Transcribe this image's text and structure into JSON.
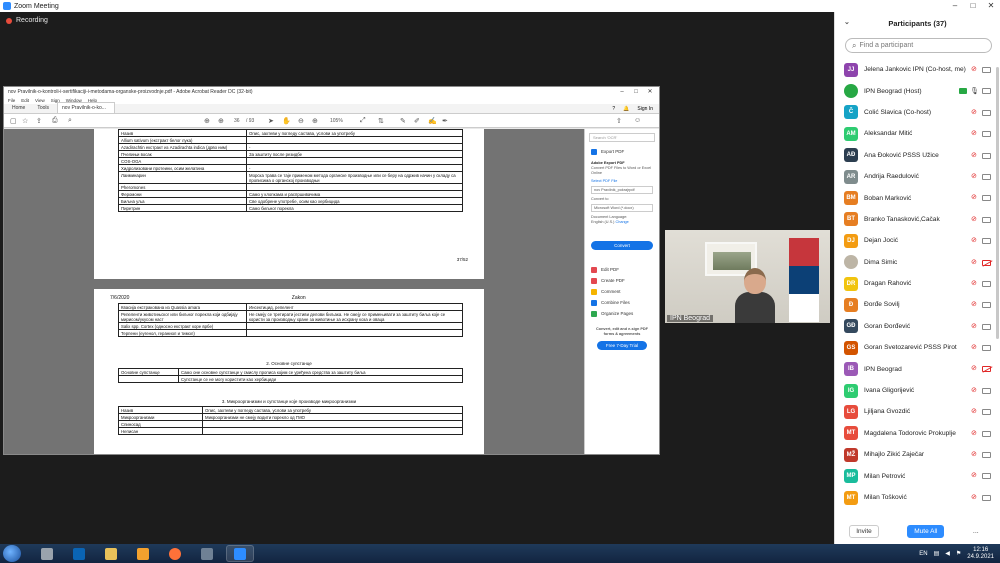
{
  "zoom": {
    "window_title": "Zoom Meeting",
    "recording_label": "Recording"
  },
  "acrobat": {
    "title": "nov Pravilnik-o-kontroli-i-sertifikaciji-i-metodama-organske-proizvodnje.pdf - Adobe Acrobat Reader DC (32-bit)",
    "menu": [
      "File",
      "Edit",
      "View",
      "Sign",
      "Window",
      "Help"
    ],
    "tabs": [
      "Home",
      "Tools",
      "nov Pravilnik-o-ko..."
    ],
    "sign_in": "Sign In",
    "page_indicator": "36",
    "page_total": "/ 93",
    "zoom_level": "105%",
    "page1": {
      "rows": [
        [
          "Назив",
          "Опис, захтеви у погледу састава, услови за употребу"
        ],
        [
          "Allium sativum (екстракт белог лука)",
          ""
        ],
        [
          "Azadirachtin екстракт из Azadirachta indica (дрво ним)",
          "-"
        ],
        [
          "Пчелињи восак",
          "За заштиту после резидбе"
        ],
        [
          "COS-OGA",
          ""
        ],
        [
          "Хидролизовани протеини, осим желатина",
          "-"
        ],
        [
          "Лаиминарин",
          "Морска трава се тaje применом метода органске производње или се беру на одржив начин у складу са прописима о органској производњи"
        ],
        [
          "Pheromones",
          ""
        ],
        [
          "Феромони",
          "Само у клопкама и распршивачима"
        ],
        [
          "Биљна уља",
          "Све одобрене употребе, осим као хербицида"
        ],
        [
          "Пиретрин",
          "Само биљног порекла"
        ]
      ],
      "page_number": "37/52"
    },
    "page2": {
      "date": "7/6/2020",
      "header_title": "Zakon",
      "rows": [
        [
          "Квасија екстракована из Quassia amara",
          "Инсектицид, репелент"
        ],
        [
          "Репеленти животињског или биљног порекла који одбијају мирисом/укусом наст",
          "Не смеју се третирати јестиви делови биљака. Не смеју се примењивати за заштиту биља које се користи за производњу хране за животиње за исхрану коза и оваца"
        ],
        [
          "Salix spp. Cortex (односно екстракт коре врбе)",
          ""
        ],
        [
          "Терпени (еугенол, гераниол и тимол)",
          ""
        ]
      ],
      "section2_title": "2. Основне супстанце",
      "section2_rows": [
        [
          "Основне супстанце",
          "Само оне основне супстанце у смислу прописа којим се уређена средства за заштиту биља"
        ],
        [
          "",
          "Супстанце се не могу користити као хербициди"
        ]
      ],
      "section3_title": "3. Микроорганизми и супстанце које производе микроорганизми",
      "section3_rows": [
        [
          "Назив",
          "Опис, захтеви у погледу састава, услови за употребу"
        ],
        [
          "Микроорганизми",
          "Микроорганизми не смеју водити порекло од ГМО"
        ],
        [
          "Спиносад",
          ""
        ],
        [
          "Неписан",
          ""
        ]
      ]
    },
    "right_panel": {
      "search_placeholder": "Search 'OCR'",
      "export_pdf": "Export PDF",
      "adobe_export_title": "Adobe Export PDF",
      "adobe_export_desc": "Convert PDF Files to Word or Excel Online",
      "select_pdf": "Select PDF File",
      "selected_file": "nov Pravilnik_pokrajrpdf",
      "convert_to": "Convert to",
      "format": "Microsoft Word (*.docx)",
      "doc_lang": "Document Language:",
      "lang_value": "English (U.S.)",
      "change": "Change",
      "convert_btn": "Convert",
      "tools": [
        "Edit PDF",
        "Create PDF",
        "Comment",
        "Combine Files",
        "Organize Pages"
      ],
      "promo": "Convert, edit and e-sign PDF forms & agreements",
      "trial_btn": "Free 7-Day Trial"
    }
  },
  "video": {
    "name": "IPN Beograd"
  },
  "participants": {
    "title": "Participants (37)",
    "search_placeholder": "Find a participant",
    "list": [
      {
        "initials": "JJ",
        "name": "Jelena Jankovic IPN (Co-host, me)",
        "color": "#8e44ad",
        "mic": "muted",
        "cam": "off"
      },
      {
        "initials": "",
        "name": "IPN Beograd (Host)",
        "color": "#27a844",
        "mic": "on",
        "cam": "on",
        "photo": true
      },
      {
        "initials": "Č",
        "name": "Čolić Slavica (Co-host)",
        "color": "#16a3c6",
        "mic": "muted",
        "cam": "off"
      },
      {
        "initials": "AM",
        "name": "Aleksandar Mitić",
        "color": "#2ecc71",
        "mic": "muted",
        "cam": "off"
      },
      {
        "initials": "AĐ",
        "name": "Ana Đoković PSSS Užice",
        "color": "#2c3e50",
        "mic": "muted",
        "cam": "off"
      },
      {
        "initials": "AR",
        "name": "Andrija Raedulović",
        "color": "#7f8c8d",
        "mic": "muted",
        "cam": "off"
      },
      {
        "initials": "BM",
        "name": "Boban Marković",
        "color": "#e67e22",
        "mic": "muted",
        "cam": "off"
      },
      {
        "initials": "BT",
        "name": "Branko Tanasković,Čačak",
        "color": "#e67e22",
        "mic": "muted",
        "cam": "off"
      },
      {
        "initials": "DJ",
        "name": "Dejan Jocić",
        "color": "#f39c12",
        "mic": "muted",
        "cam": "off"
      },
      {
        "initials": "",
        "name": "Dima Simic",
        "color": "#bdb5a6",
        "mic": "muted",
        "cam": "red",
        "photo": true
      },
      {
        "initials": "DR",
        "name": "Dragan Rahović",
        "color": "#f1c40f",
        "mic": "muted",
        "cam": "off"
      },
      {
        "initials": "Đ",
        "name": "Đorđe Sovilj",
        "color": "#e67e22",
        "mic": "muted",
        "cam": "off"
      },
      {
        "initials": "GĐ",
        "name": "Goran Đorđević",
        "color": "#34495e",
        "mic": "muted",
        "cam": "off"
      },
      {
        "initials": "GS",
        "name": "Goran Svetozarević PSSS Pirot",
        "color": "#d35400",
        "mic": "muted",
        "cam": "off"
      },
      {
        "initials": "IB",
        "name": "IPN Beograd",
        "color": "#9b59b6",
        "mic": "muted",
        "cam": "red"
      },
      {
        "initials": "IG",
        "name": "Ivana Gligorijević",
        "color": "#2ecc71",
        "mic": "muted",
        "cam": "off"
      },
      {
        "initials": "LG",
        "name": "Ljiljana Gvozdić",
        "color": "#e74c3c",
        "mic": "muted",
        "cam": "off"
      },
      {
        "initials": "MT",
        "name": "Magdalena Todorovic Prokuplje",
        "color": "#e74c3c",
        "mic": "muted",
        "cam": "off"
      },
      {
        "initials": "MŽ",
        "name": "Mihajlo Žikić Zaječar",
        "color": "#c0392b",
        "mic": "muted",
        "cam": "off"
      },
      {
        "initials": "MP",
        "name": "Milan Petrović",
        "color": "#1abc9c",
        "mic": "muted",
        "cam": "off"
      },
      {
        "initials": "MT",
        "name": "Milan Tošković",
        "color": "#f39c12",
        "mic": "muted",
        "cam": "off"
      }
    ],
    "invite_label": "Invite",
    "mute_all_label": "Mute All",
    "more_label": "..."
  },
  "taskbar": {
    "lang": "EN",
    "time": "12:16",
    "date": "24.9.2021",
    "apps": [
      "media-player",
      "outlook",
      "explorer",
      "media",
      "firefox",
      "teamviewer",
      "zoom"
    ]
  },
  "colors": {
    "zoom_blue": "#2d8cff",
    "muted_red": "#e02828",
    "acrobat_blue": "#1473e6"
  }
}
